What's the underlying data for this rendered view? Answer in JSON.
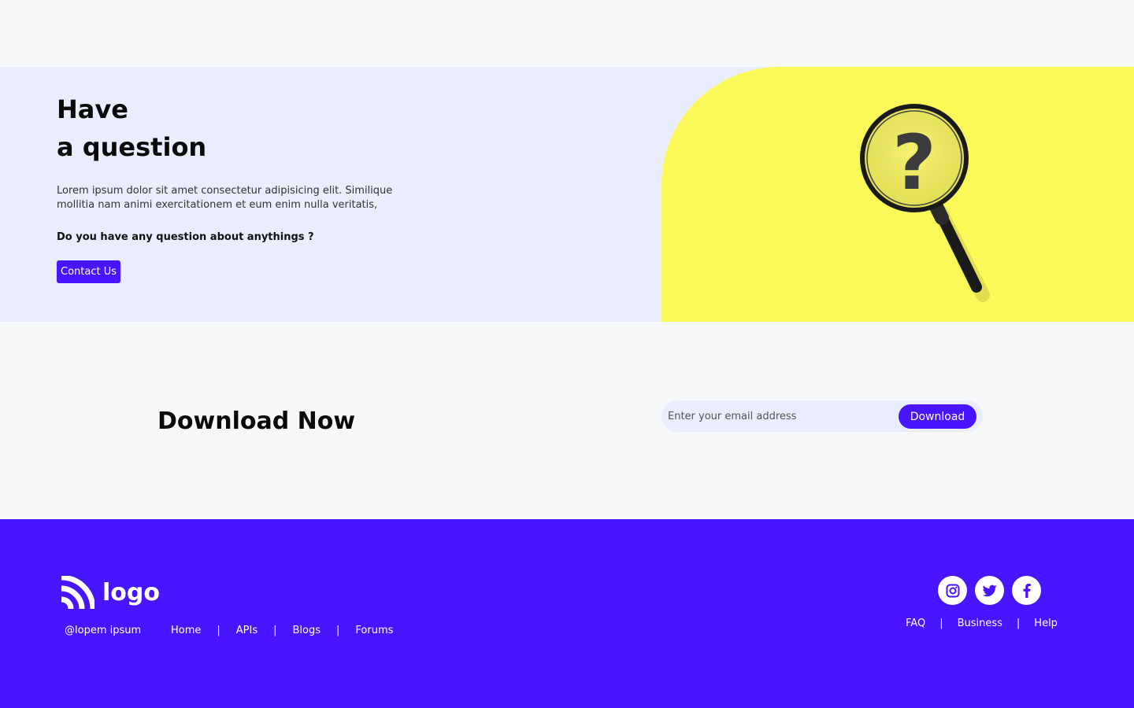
{
  "hero": {
    "title_line1": "Have",
    "title_line2": "a question",
    "description": "Lorem ipsum dolor sit amet consectetur adipisicing elit. Similique mollitia nam animi exercitationem et eum enim nulla veritatis,",
    "question": "Do you have any question about anythings ?",
    "contact_label": "Contact Us",
    "image_bg_color": "#fbf85a",
    "image_icon": "magnifier-question-icon"
  },
  "download": {
    "title_bold": "Download",
    "title_rest": "Now",
    "email_placeholder": "Enter your email address",
    "button_label": "Download"
  },
  "footer": {
    "logo_text": "logo",
    "logo_icon": "rss-logo-icon",
    "copyright": "@lopem ipsum",
    "nav": [
      "Home",
      "APIs",
      "Blogs",
      "Forums"
    ],
    "separator": "|",
    "social": [
      "instagram-icon",
      "twitter-icon",
      "facebook-icon"
    ],
    "right_nav": [
      "FAQ",
      "Business",
      "Help"
    ]
  },
  "colors": {
    "accent": "#4715ff",
    "hero_bg": "#e9edfd",
    "page_bg": "#f7f8fa"
  }
}
